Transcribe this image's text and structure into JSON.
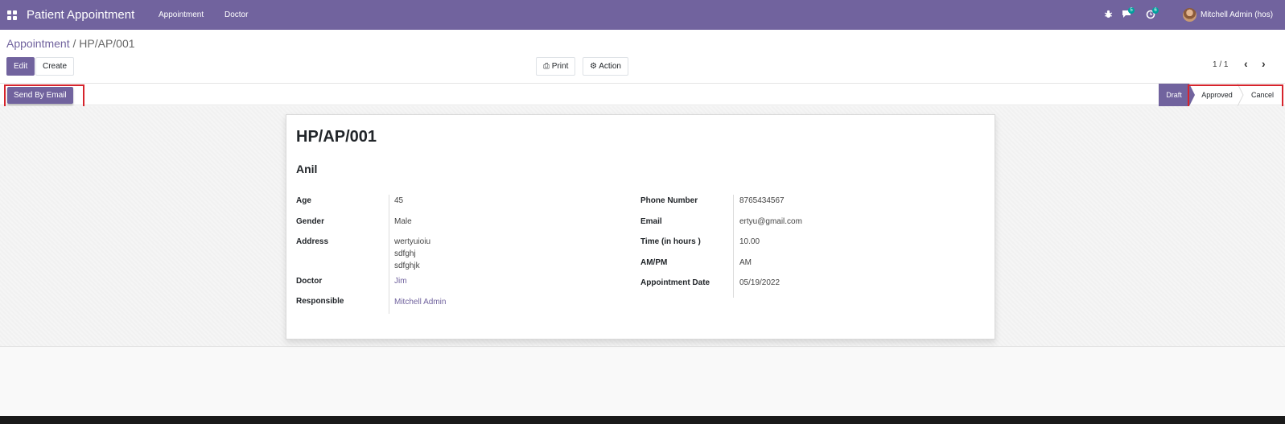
{
  "navbar": {
    "app_title": "Patient Appointment",
    "menu": [
      "Appointment",
      "Doctor"
    ],
    "messages_count": "5",
    "activities_count": "6",
    "user_name": "Mitchell Admin (hos)"
  },
  "breadcrumb": {
    "parent": "Appointment",
    "separator": " / ",
    "current": "HP/AP/001"
  },
  "toolbar": {
    "edit_label": "Edit",
    "create_label": "Create",
    "print_label": "Print",
    "action_label": "Action",
    "pager_value": "1 / 1"
  },
  "statusbar": {
    "send_email_label": "Send By Email",
    "stages": [
      "Draft",
      "Approved",
      "Cancel"
    ],
    "active_stage": "Draft"
  },
  "record": {
    "reference": "HP/AP/001",
    "patient_name": "Anil",
    "left_fields": [
      {
        "label": "Age",
        "value": "45"
      },
      {
        "label": "Gender",
        "value": "Male"
      },
      {
        "label": "Address",
        "lines": [
          "wertyuioiu",
          "sdfghj",
          "sdfghjk"
        ]
      },
      {
        "label": "Doctor",
        "value": "Jim"
      },
      {
        "label": "Responsible",
        "value": "Mitchell Admin"
      }
    ],
    "right_fields": [
      {
        "label": "Phone Number",
        "value": "8765434567"
      },
      {
        "label": "Email",
        "value": "ertyu@gmail.com"
      },
      {
        "label": "Time (in hours )",
        "value": "10.00"
      },
      {
        "label": "AM/PM",
        "value": "AM"
      },
      {
        "label": "Appointment Date",
        "value": "05/19/2022"
      }
    ]
  },
  "colors": {
    "brand": "#71639e",
    "highlight": "#d6242c",
    "badge": "#00a09d"
  }
}
